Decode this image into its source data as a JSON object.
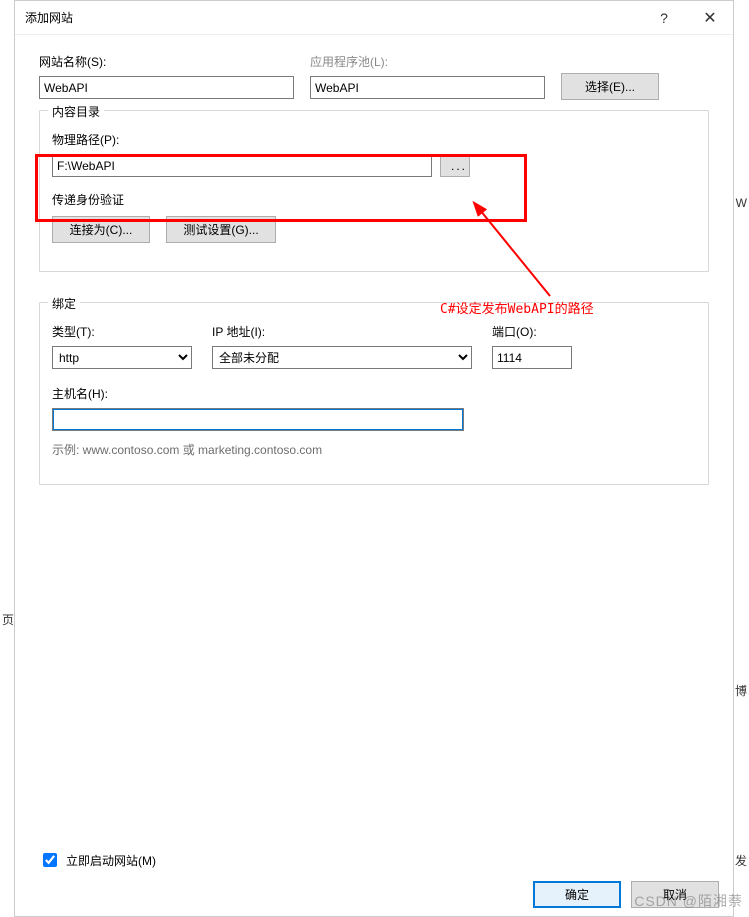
{
  "titlebar": {
    "title": "添加网站",
    "help": "?",
    "close": "✕"
  },
  "site": {
    "name_label": "网站名称(S):",
    "name_value": "WebAPI",
    "pool_label": "应用程序池(L):",
    "pool_value": "WebAPI",
    "select_btn": "选择(E)..."
  },
  "content_dir": {
    "legend": "内容目录",
    "path_label": "物理路径(P):",
    "path_value": "F:\\WebAPI",
    "browse_btn": "...",
    "auth_label": "传递身份验证",
    "connect_btn": "连接为(C)...",
    "test_btn": "测试设置(G)..."
  },
  "binding": {
    "legend": "绑定",
    "type_label": "类型(T):",
    "type_value": "http",
    "ip_label": "IP 地址(I):",
    "ip_value": "全部未分配",
    "port_label": "端口(O):",
    "port_value": "1114",
    "host_label": "主机名(H):",
    "host_value": "",
    "example": "示例: www.contoso.com 或 marketing.contoso.com"
  },
  "start_immediately": {
    "label": "立即启动网站(M)",
    "checked": true
  },
  "footer": {
    "ok": "确定",
    "cancel": "取消"
  },
  "annotation": {
    "text": "C#设定发布WebAPI的路径"
  },
  "watermark": {
    "text": "CSDN @陌湘萘"
  },
  "edge_letters": {
    "left": "页",
    "right_top": "W",
    "right_mid": "博",
    "right_bottom": "发"
  }
}
